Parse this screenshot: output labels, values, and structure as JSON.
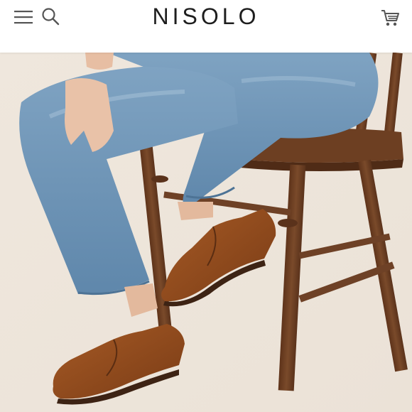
{
  "header": {
    "brand": "NISOLO",
    "icons": {
      "menu": "hamburger-menu-icon",
      "search": "search-icon",
      "cart": "shopping-cart-icon"
    }
  },
  "hero": {
    "image_subject": "",
    "colors": {
      "background": "#efe8df",
      "denim": "#6f96b8",
      "leather": "#8e4b1f",
      "wood": "#6a3e22"
    }
  },
  "colors": {
    "text": "#1e1e1e",
    "icon": "#555555"
  }
}
